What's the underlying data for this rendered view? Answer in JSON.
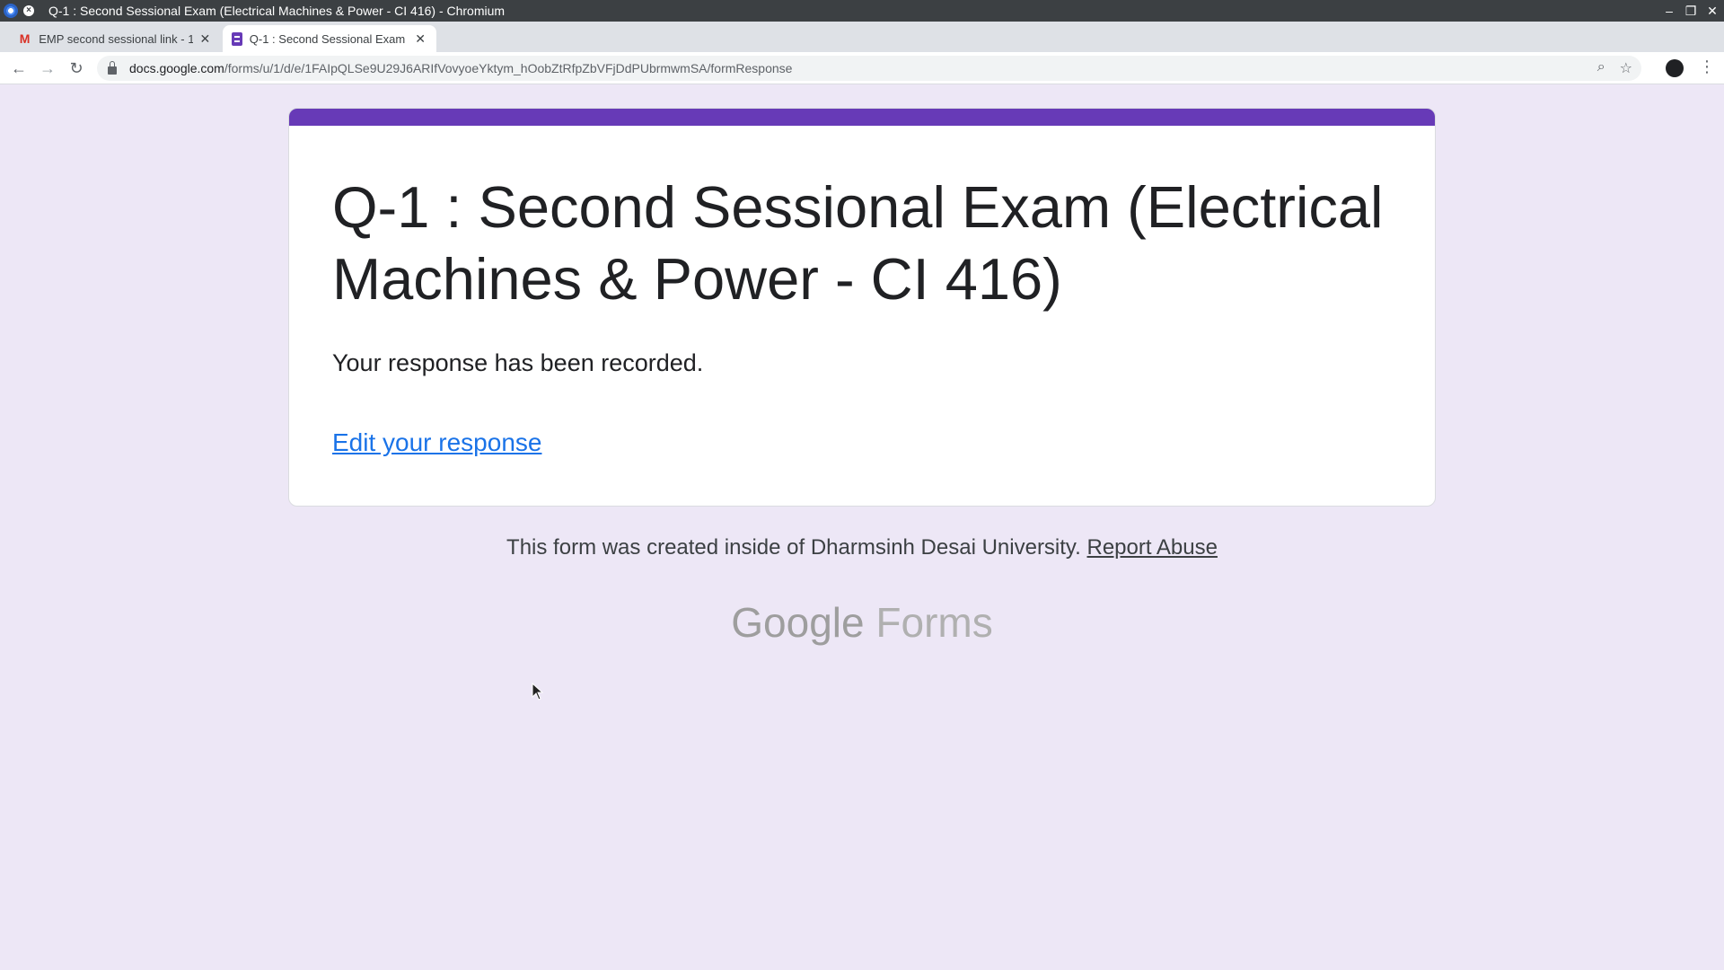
{
  "window": {
    "title": "Q-1 : Second Sessional Exam (Electrical Machines & Power - CI 416) - Chromium",
    "controls": [
      "minimize-icon",
      "restore-icon",
      "close-icon"
    ]
  },
  "tabs": [
    {
      "label": "EMP second sessional link - 1",
      "icon": "gmail-icon",
      "active": false
    },
    {
      "label": "Q-1 : Second Sessional Exam (",
      "icon": "forms-icon",
      "active": true
    }
  ],
  "toolbar": {
    "url_host": "docs.google.com",
    "url_path": "/forms/u/1/d/e/1FAIpQLSe9U29J6ARIfVovyoeYktym_hOobZtRfpZbVFjDdPUbrmwmSA/formResponse"
  },
  "form": {
    "title": "Q-1 : Second Sessional Exam (Electrical Machines & Power - CI 416)",
    "response_message": "Your response has been recorded.",
    "edit_link": "Edit your response",
    "accent_color": "#673ab7"
  },
  "footer": {
    "note": "This form was created inside of Dharmsinh Desai University.",
    "report_abuse": "Report Abuse",
    "brand_google": "Google",
    "brand_forms": "Forms"
  }
}
